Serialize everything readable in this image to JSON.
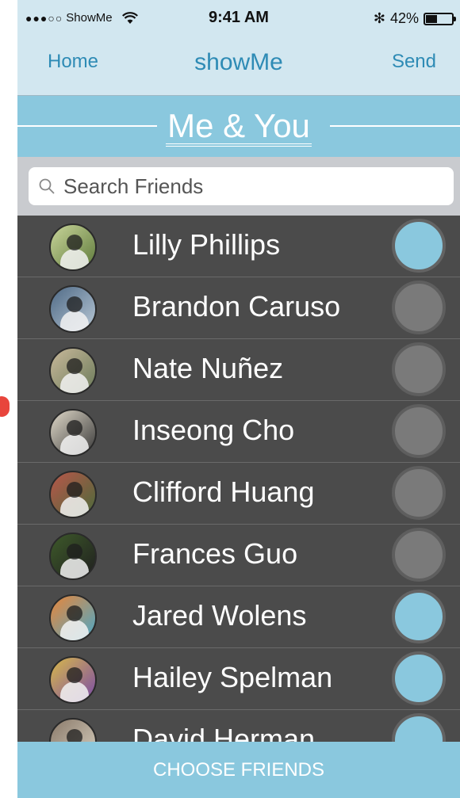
{
  "status": {
    "carrier": "ShowMe",
    "signal_dots": "●●●○○",
    "time": "9:41 AM",
    "bluetooth": "✻",
    "battery": "42%",
    "battery_level": 0.42
  },
  "navbar": {
    "home_label": "Home",
    "title": "showMe",
    "send_label": "Send"
  },
  "banner": {
    "heading": "Me & You"
  },
  "search": {
    "placeholder": "Search Friends",
    "value": ""
  },
  "friends": [
    {
      "name": "Lilly Phillips",
      "selected": true,
      "avatar_colors": [
        "#c9d59a",
        "#5e7a3b"
      ]
    },
    {
      "name": "Brandon Caruso",
      "selected": false,
      "avatar_colors": [
        "#4f6a86",
        "#b8c8d6"
      ]
    },
    {
      "name": "Nate Nuñez",
      "selected": false,
      "avatar_colors": [
        "#c8b89a",
        "#6b7b5a"
      ]
    },
    {
      "name": "Inseong Cho",
      "selected": false,
      "avatar_colors": [
        "#dfd8c8",
        "#3a3a3a"
      ]
    },
    {
      "name": "Clifford Huang",
      "selected": false,
      "avatar_colors": [
        "#b8564a",
        "#4a6b3a"
      ]
    },
    {
      "name": "Frances Guo",
      "selected": false,
      "avatar_colors": [
        "#3e5a2a",
        "#1f1f1f"
      ]
    },
    {
      "name": "Jared Wolens",
      "selected": true,
      "avatar_colors": [
        "#e8863a",
        "#4aa8c8"
      ]
    },
    {
      "name": "Hailey Spelman",
      "selected": true,
      "avatar_colors": [
        "#d8b84a",
        "#7a4aa8"
      ]
    },
    {
      "name": "David Herman",
      "selected": true,
      "avatar_colors": [
        "#8a7a6a",
        "#d8d0c0"
      ]
    }
  ],
  "bottom_button": {
    "label": "CHOOSE FRIENDS"
  },
  "colors": {
    "accent": "#8ac8de",
    "nav_text": "#2e8bb5",
    "list_bg": "#4b4b4b",
    "toggle_off": "#7a7a7a"
  }
}
